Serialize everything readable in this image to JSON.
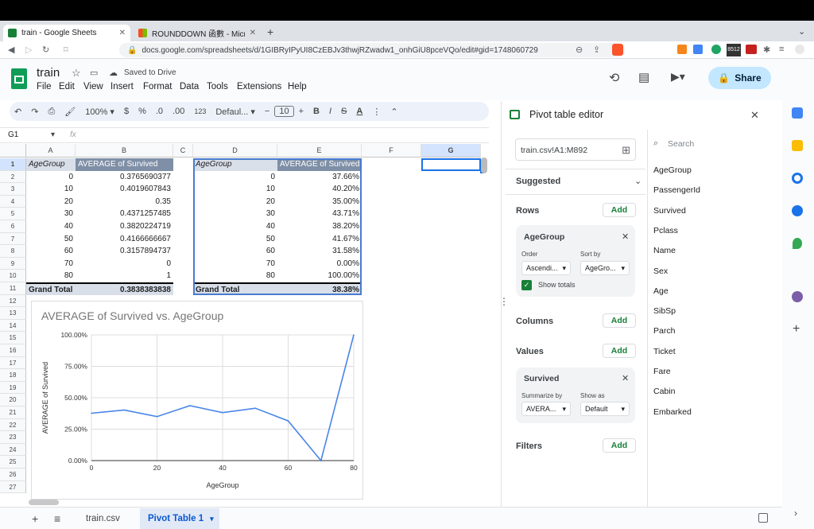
{
  "browser": {
    "tabs": [
      {
        "title": "train - Google Sheets"
      },
      {
        "title": "ROUNDDOWN 函數 - Microsoft 支援"
      }
    ],
    "url": "docs.google.com/spreadsheets/d/1GIBRyIPyUI8CzEBJv3thwjRZwadw1_onhGiU8pceVQo/edit#gid=1748060729",
    "ext_badge": "8512"
  },
  "doc": {
    "title": "train",
    "saved": "Saved to Drive",
    "share_label": "Share"
  },
  "menu": [
    "File",
    "Edit",
    "View",
    "Insert",
    "Format",
    "Data",
    "Tools",
    "Extensions",
    "Help"
  ],
  "toolbar": {
    "zoom": "100%",
    "currency": "$",
    "percent": "%",
    "dec_less": ".0",
    "dec_more": ".00",
    "num_format": "123",
    "font": "Defaul...",
    "font_size": "10",
    "bold": "B",
    "italic": "I",
    "strike": "S",
    "text_color": "A"
  },
  "formula_bar": {
    "cell_ref": "G1",
    "fx": "fx",
    "value": ""
  },
  "columns": [
    "A",
    "B",
    "C",
    "D",
    "E",
    "F",
    "G"
  ],
  "rows": [
    "1",
    "2",
    "3",
    "4",
    "5",
    "6",
    "7",
    "8",
    "9",
    "10",
    "11",
    "12",
    "13",
    "14",
    "15",
    "16",
    "17",
    "18",
    "19",
    "20",
    "21",
    "22",
    "23",
    "24",
    "25",
    "26",
    "27"
  ],
  "table1": {
    "headers": [
      "AgeGroup",
      "AVERAGE of Survived"
    ],
    "rows": [
      [
        "0",
        "0.3765690377"
      ],
      [
        "10",
        "0.4019607843"
      ],
      [
        "20",
        "0.35"
      ],
      [
        "30",
        "0.4371257485"
      ],
      [
        "40",
        "0.3820224719"
      ],
      [
        "50",
        "0.4166666667"
      ],
      [
        "60",
        "0.3157894737"
      ],
      [
        "70",
        "0"
      ],
      [
        "80",
        "1"
      ]
    ],
    "total": [
      "Grand Total",
      "0.3838383838"
    ]
  },
  "table2": {
    "headers": [
      "AgeGroup",
      "AVERAGE of Survived"
    ],
    "rows": [
      [
        "0",
        "37.66%"
      ],
      [
        "10",
        "40.20%"
      ],
      [
        "20",
        "35.00%"
      ],
      [
        "30",
        "43.71%"
      ],
      [
        "40",
        "38.20%"
      ],
      [
        "50",
        "41.67%"
      ],
      [
        "60",
        "31.58%"
      ],
      [
        "70",
        "0.00%"
      ],
      [
        "80",
        "100.00%"
      ]
    ],
    "total": [
      "Grand Total",
      "38.38%"
    ]
  },
  "chart_data": {
    "type": "line",
    "title": "AVERAGE of Survived vs. AgeGroup",
    "xlabel": "AgeGroup",
    "ylabel": "AVERAGE of Survived",
    "x": [
      0,
      10,
      20,
      30,
      40,
      50,
      60,
      70,
      80
    ],
    "series": [
      {
        "values": [
          0.3766,
          0.402,
          0.35,
          0.4371,
          0.382,
          0.4167,
          0.3158,
          0,
          1
        ]
      }
    ],
    "xticks": [
      "0",
      "20",
      "40",
      "60",
      "80"
    ],
    "yticks": [
      "0.00%",
      "25.00%",
      "50.00%",
      "75.00%",
      "100.00%"
    ],
    "ylim": [
      0,
      1
    ],
    "xlim": [
      0,
      80
    ],
    "grid": true,
    "color": "#4a86e8"
  },
  "pivot": {
    "title": "Pivot table editor",
    "range": "train.csv!A1:M892",
    "suggested": "Suggested",
    "rows_label": "Rows",
    "columns_label": "Columns",
    "values_label": "Values",
    "filters_label": "Filters",
    "add": "Add",
    "rows_card": {
      "name": "AgeGroup",
      "order_label": "Order",
      "order_value": "Ascendi...",
      "sort_label": "Sort by",
      "sort_value": "AgeGro...",
      "show_totals": "Show totals"
    },
    "values_card": {
      "name": "Survived",
      "summarize_label": "Summarize by",
      "summarize_value": "AVERA...",
      "show_as_label": "Show as",
      "show_as_value": "Default"
    },
    "search_placeholder": "Search",
    "fields": [
      "AgeGroup",
      "PassengerId",
      "Survived",
      "Pclass",
      "Name",
      "Sex",
      "Age",
      "SibSp",
      "Parch",
      "Ticket",
      "Fare",
      "Cabin",
      "Embarked"
    ]
  },
  "sheets": [
    {
      "name": "train.csv"
    },
    {
      "name": "Pivot Table 1"
    }
  ],
  "colors": {
    "accent": "#0b57d0",
    "share_bg": "#c2e7ff",
    "green": "#188038",
    "sheet_active": "#e1e9f7"
  }
}
